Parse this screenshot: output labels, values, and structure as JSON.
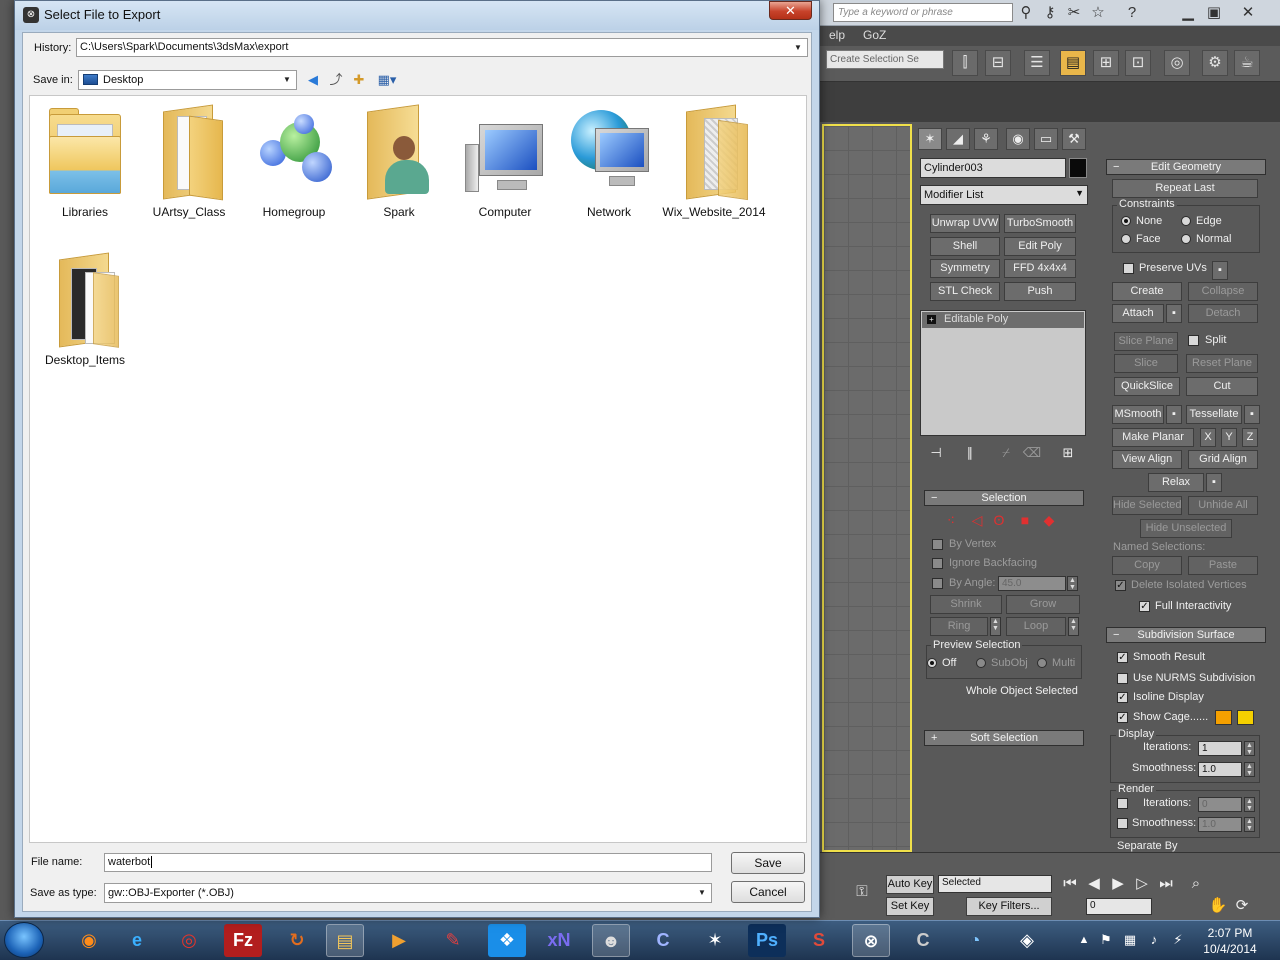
{
  "dialog": {
    "title": "Select File to Export",
    "close_label": "✕",
    "history_label": "History:",
    "history_value": "C:\\Users\\Spark\\Documents\\3dsMax\\export",
    "save_in_label": "Save in:",
    "save_in_value": "Desktop",
    "items": [
      {
        "name": "Libraries"
      },
      {
        "name": "UArtsy_Class"
      },
      {
        "name": "Homegroup"
      },
      {
        "name": "Spark"
      },
      {
        "name": "Computer"
      },
      {
        "name": "Network"
      },
      {
        "name": "Wix_Website_2014"
      },
      {
        "name": "Desktop_Items"
      }
    ],
    "file_name_label": "File name:",
    "file_name_value": "waterbot",
    "save_type_label": "Save as type:",
    "save_type_value": "gw::OBJ-Exporter (*.OBJ)",
    "save_button": "Save",
    "cancel_button": "Cancel"
  },
  "max": {
    "search_placeholder": "Type a keyword or phrase",
    "menu_help": "elp",
    "menu_goz": "GoZ",
    "selection_set_placeholder": "Create Selection Se",
    "object_name": "Cylinder003",
    "object_color": "#0a0a0a",
    "modifier_list": "Modifier List",
    "modifier_buttons": [
      "Unwrap UVW",
      "TurboSmooth",
      "Shell",
      "Edit Poly",
      "Symmetry",
      "FFD 4x4x4",
      "STL Check",
      "Push"
    ],
    "stack_item": "Editable Poly",
    "selection": {
      "header": "Selection",
      "by_vertex": "By Vertex",
      "ignore_backfacing": "Ignore Backfacing",
      "by_angle": "By Angle:",
      "by_angle_value": "45.0",
      "shrink": "Shrink",
      "grow": "Grow",
      "ring": "Ring",
      "loop": "Loop",
      "preview_selection": "Preview Selection",
      "off": "Off",
      "subobj": "SubObj",
      "multi": "Multi",
      "status": "Whole Object Selected"
    },
    "soft_selection": "Soft Selection",
    "edit_geometry": {
      "header": "Edit Geometry",
      "repeat_last": "Repeat Last",
      "constraints": "Constraints",
      "none": "None",
      "edge": "Edge",
      "face": "Face",
      "normal": "Normal",
      "preserve_uvs": "Preserve UVs",
      "create": "Create",
      "collapse": "Collapse",
      "attach": "Attach",
      "detach": "Detach",
      "slice_plane": "Slice Plane",
      "split": "Split",
      "slice": "Slice",
      "reset_plane": "Reset Plane",
      "quickslice": "QuickSlice",
      "cut": "Cut",
      "msmooth": "MSmooth",
      "tessellate": "Tessellate",
      "make_planar": "Make Planar",
      "x": "X",
      "y": "Y",
      "z": "Z",
      "view_align": "View Align",
      "grid_align": "Grid Align",
      "relax": "Relax",
      "hide_selected": "Hide Selected",
      "unhide_all": "Unhide All",
      "hide_unselected": "Hide Unselected",
      "named_selections": "Named Selections:",
      "copy": "Copy",
      "paste": "Paste",
      "delete_isolated": "Delete Isolated Vertices",
      "full_interactivity": "Full Interactivity"
    },
    "subdivision": {
      "header": "Subdivision Surface",
      "smooth_result": "Smooth Result",
      "use_nurms": "Use NURMS Subdivision",
      "isoline_display": "Isoline Display",
      "show_cage": "Show Cage......",
      "cage_color_1": "#f5a000",
      "cage_color_2": "#f5d000",
      "display": "Display",
      "iterations_label": "Iterations:",
      "display_iterations": "1",
      "smoothness_label": "Smoothness:",
      "display_smoothness": "1.0",
      "render": "Render",
      "render_iterations": "0",
      "render_smoothness": "1.0",
      "separate_by": "Separate By"
    },
    "bottom": {
      "auto_key": "Auto Key",
      "set_key": "Set Key",
      "selected": "Selected",
      "key_filters": "Key Filters...",
      "frame": "0"
    }
  },
  "taskbar": {
    "time": "2:07 PM",
    "date": "10/4/2014"
  }
}
